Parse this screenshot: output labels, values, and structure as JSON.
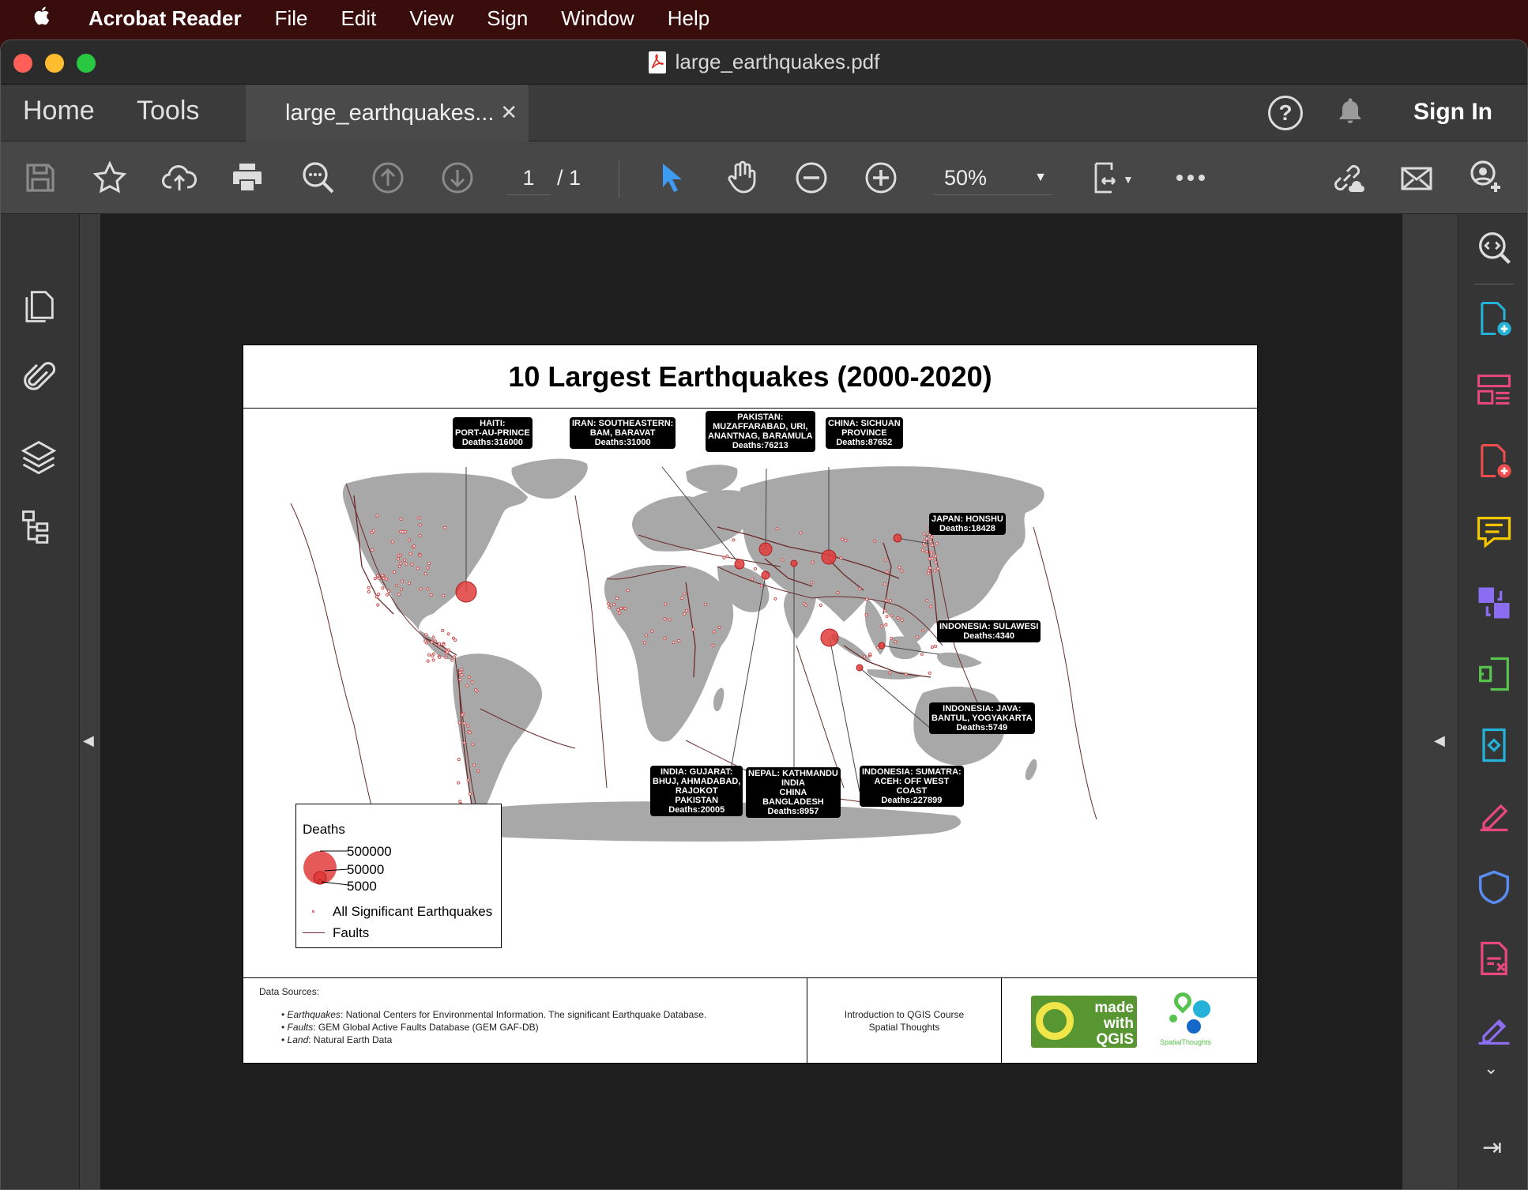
{
  "menubar": {
    "app": "Acrobat Reader",
    "items": [
      "File",
      "Edit",
      "View",
      "Sign",
      "Window",
      "Help"
    ]
  },
  "window": {
    "title": "large_earthquakes.pdf"
  },
  "tabs": {
    "home": "Home",
    "tools": "Tools",
    "doc": "large_earthquakes...",
    "sign_in": "Sign In"
  },
  "toolbar": {
    "page_current": "1",
    "page_total": "/ 1",
    "zoom": "50%"
  },
  "map": {
    "title": "10 Largest Earthquakes (2000-2020)",
    "callouts": [
      "HAITI:\nPORT-AU-PRINCE\nDeaths:316000",
      "IRAN:  SOUTHEASTERN:\nBAM, BARAVAT\nDeaths:31000",
      "PAKISTAN:\nMUZAFFARABAD, URI,\nANANTNAG, BARAMULA\nDeaths:76213",
      "CHINA:  SICHUAN\nPROVINCE\nDeaths:87652",
      "JAPAN:  HONSHU\nDeaths:18428",
      "INDONESIA:  SULAWESI\nDeaths:4340",
      "INDONESIA:  JAVA:\nBANTUL, YOGYAKARTA\nDeaths:5749",
      "INDONESIA:  SUMATRA:\nACEH:  OFF WEST\nCOAST\nDeaths:227899",
      "NEPAL:  KATHMANDU\nINDIA\nCHINA\nBANGLADESH\nDeaths:8957",
      "INDIA:  GUJARAT:\nBHUJ, AHMADABAD,\nRAJOKOT\nPAKISTAN\nDeaths:20005"
    ],
    "legend": {
      "title": "Deaths",
      "sizes": [
        "500000",
        "50000",
        "5000"
      ],
      "points": "All Significant Earthquakes",
      "faults": "Faults"
    }
  },
  "footer": {
    "sources_title": "Data Sources:",
    "sources": [
      {
        "name": "Earthquakes",
        "text": ": National Centers for Environmental Information. The significant Earthquake Database."
      },
      {
        "name": "Faults",
        "text": ": GEM Global Active Faults Database (GEM GAF-DB)"
      },
      {
        "name": "Land",
        "text": ": Natural Earth Data"
      }
    ],
    "course_line1": "Introduction to QGIS Course",
    "course_line2": "Spatial Thoughts",
    "qgis_logo": "made with QGIS",
    "st_logo": "SpatialThoughts"
  },
  "colors": {
    "quake": "#e03c3c",
    "land": "#a8a8a8",
    "fault": "#6b2a2a"
  }
}
